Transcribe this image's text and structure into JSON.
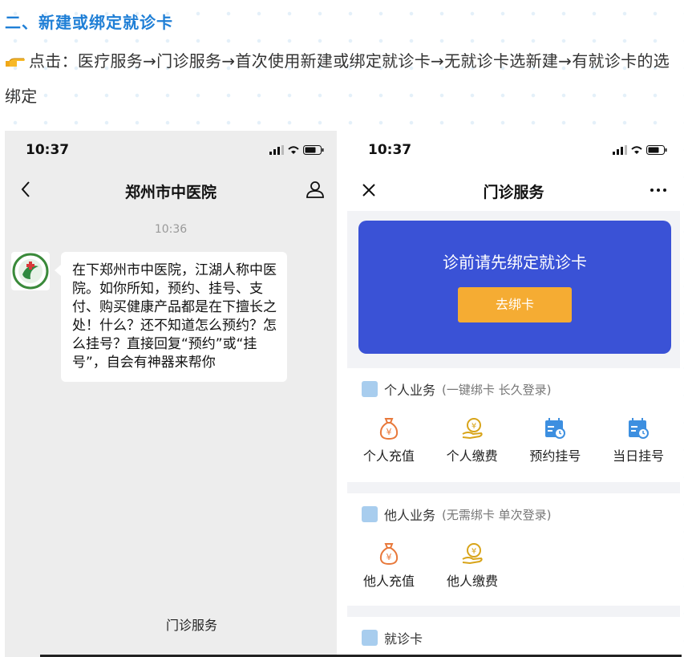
{
  "heading": "二、新建或绑定就诊卡",
  "instruction": {
    "icon": "pointing-hand-icon",
    "text": "点击：医疗服务→门诊服务→首次使用新建或绑定就诊卡→无就诊卡选新建→有就诊卡的选绑定"
  },
  "left_phone": {
    "status_time": "10:37",
    "nav_title": "郑州市中医院",
    "nav_left_icon": "back-chevron-icon",
    "nav_right_icon": "profile-icon",
    "chat_time": "10:36",
    "avatar_icon": "hospital-logo",
    "message": "在下郑州市中医院，江湖人称中医院。如你所知，预约、挂号、支付、购买健康产品都是在下擅长之处！什么？还不知道怎么预约？怎么挂号？直接回复“预约”或“挂号”，自会有神器来帮你",
    "menu_button": "门诊服务"
  },
  "right_phone": {
    "status_time": "10:37",
    "nav_title": "门诊服务",
    "nav_left_icon": "close-icon",
    "nav_right_icon": "more-icon",
    "banner_text": "诊前请先绑定就诊卡",
    "bind_button": "去绑卡",
    "section1": {
      "title": "个人业务",
      "subtitle": "(一键绑卡 长久登录)",
      "items": [
        {
          "label": "个人充值",
          "icon": "money-bag-icon"
        },
        {
          "label": "个人缴费",
          "icon": "pay-hand-icon"
        },
        {
          "label": "预约挂号",
          "icon": "calendar-clock-icon"
        },
        {
          "label": "当日挂号",
          "icon": "calendar-clock-icon"
        }
      ]
    },
    "section2": {
      "title": "他人业务",
      "subtitle": "(无需绑卡 单次登录)",
      "items": [
        {
          "label": "他人充值",
          "icon": "money-bag-icon"
        },
        {
          "label": "他人缴费",
          "icon": "pay-hand-icon"
        }
      ]
    },
    "section3": {
      "title": "就诊卡"
    }
  },
  "colors": {
    "heading": "#1f7fd6",
    "banner": "#3a52d6",
    "bind_button": "#f5ac33",
    "icon_blue": "#3d8fe0",
    "icon_orange": "#e8783a"
  }
}
